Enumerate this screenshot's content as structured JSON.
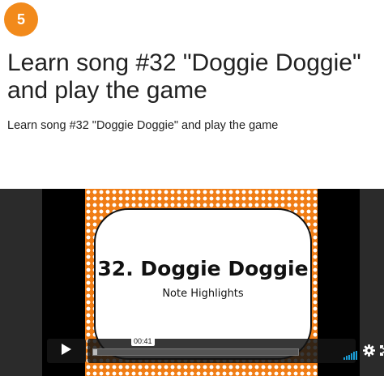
{
  "step": {
    "number": "5"
  },
  "lesson": {
    "title": "Learn song #32 \"Doggie Doggie\" and play the game",
    "subtitle": "Learn song #32 \"Doggie Doggie\" and play the game"
  },
  "video": {
    "slide_title": "32. Doggie Doggie",
    "slide_subtitle": "Note Highlights",
    "timestamp": "00:41",
    "progress": 0.02,
    "colors": {
      "accent": "#f28a1b",
      "slide_orange": "#f07d15",
      "volume": "#1a9fd9"
    },
    "icons": [
      "play-icon",
      "volume-icon",
      "gear-icon",
      "fullscreen-icon"
    ]
  }
}
